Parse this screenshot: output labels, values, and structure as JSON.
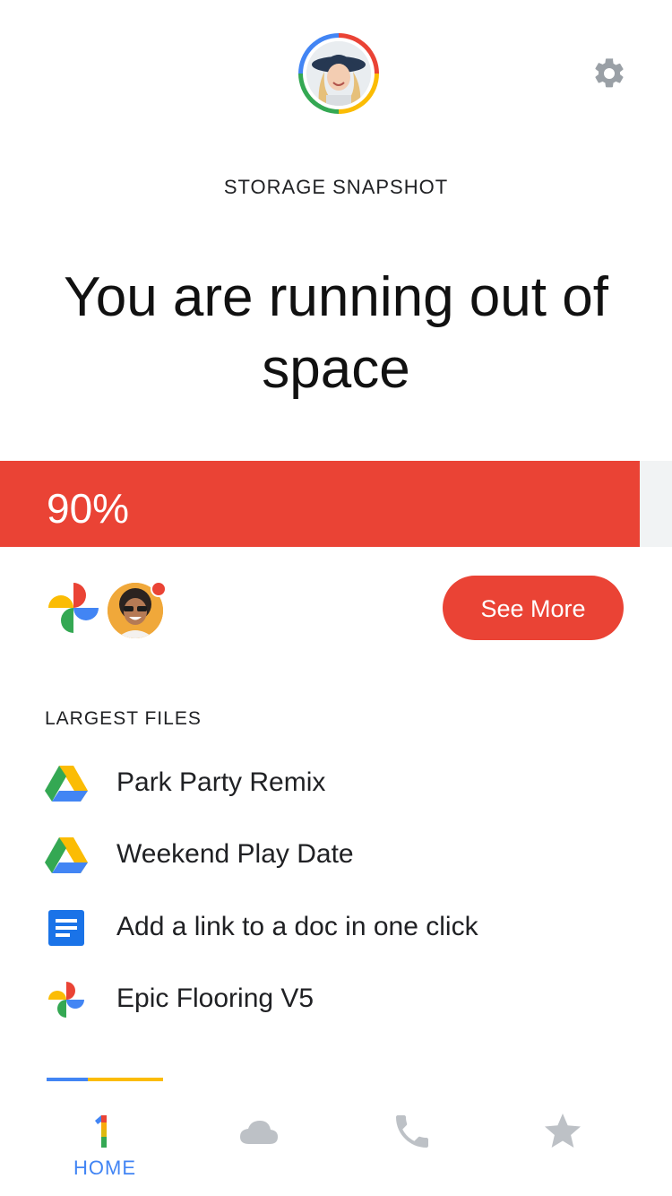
{
  "header": {
    "section_title": "STORAGE SNAPSHOT",
    "headline": "You are running out of space"
  },
  "storage": {
    "usage_percent": 90,
    "usage_label": "90%",
    "fill_color": "#ea4335",
    "track_color": "#f1f3f4"
  },
  "actions": {
    "see_more_label": "See More"
  },
  "largest_files": {
    "heading": "LARGEST FILES",
    "items": [
      {
        "name": "Park Party Remix",
        "icon": "google-drive-icon"
      },
      {
        "name": "Weekend Play Date",
        "icon": "google-drive-icon"
      },
      {
        "name": "Add a link to a doc in one click",
        "icon": "google-docs-icon"
      },
      {
        "name": "Epic Flooring V5",
        "icon": "google-photos-icon"
      }
    ]
  },
  "nav": {
    "items": [
      {
        "label": "HOME",
        "icon": "google-one-icon",
        "active": true
      },
      {
        "label": "",
        "icon": "cloud-icon",
        "active": false
      },
      {
        "label": "",
        "icon": "phone-icon",
        "active": false
      },
      {
        "label": "",
        "icon": "star-icon",
        "active": false
      }
    ]
  },
  "colors": {
    "accent_red": "#ea4335",
    "google_blue": "#4285f4",
    "google_yellow": "#fbbc04",
    "google_green": "#34a853",
    "icon_gray": "#bdc1c6"
  }
}
